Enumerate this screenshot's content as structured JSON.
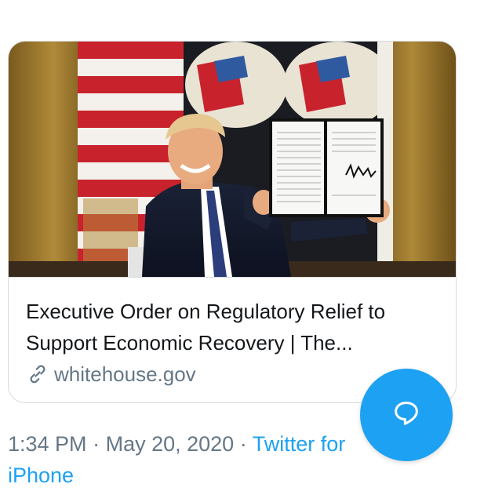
{
  "card": {
    "title": "Executive Order on Regulatory Relief to Support Economic Recovery | The...",
    "domain": "whitehouse.gov"
  },
  "meta": {
    "time": "1:34 PM",
    "separator": "·",
    "date": "May 20, 2020",
    "source": "Twitter for iPhone"
  },
  "fab": {
    "icon": "compose-reply-icon"
  },
  "colors": {
    "accent": "#1da1f2",
    "muted": "#657786",
    "text": "#14171a",
    "border": "#d6dadd"
  }
}
